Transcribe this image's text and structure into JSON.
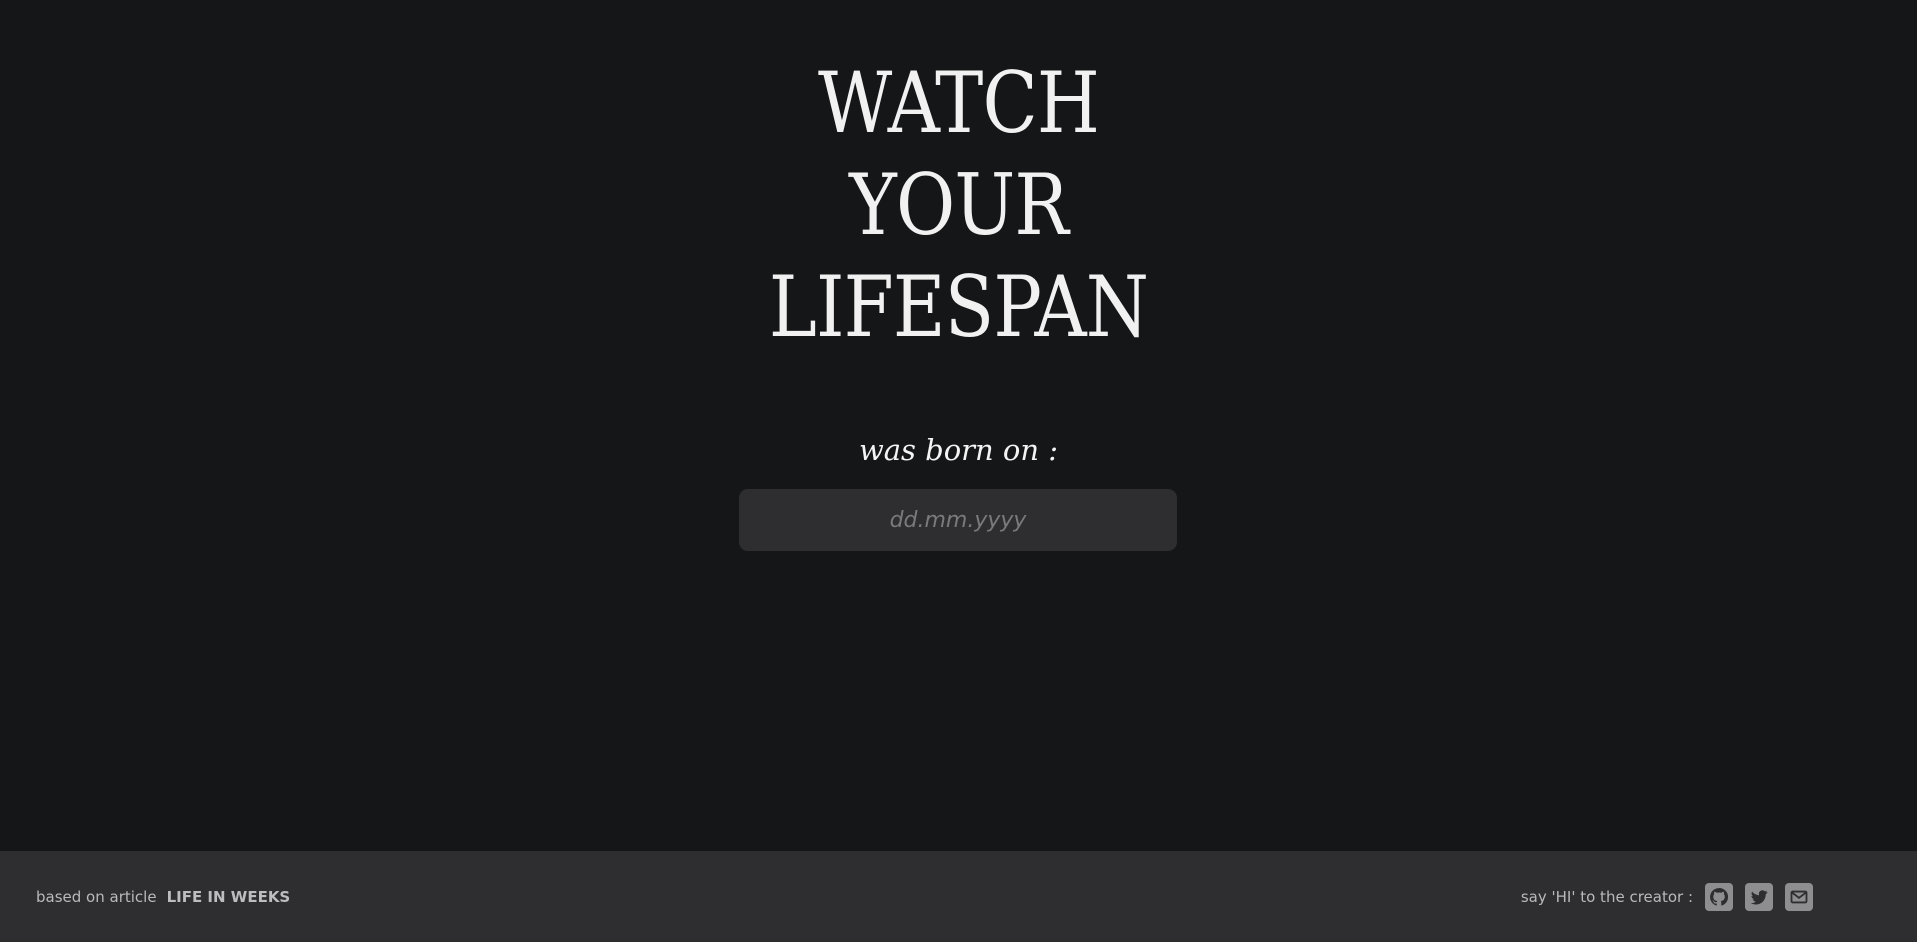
{
  "hero": {
    "title_lines": [
      "WATCH",
      "YOUR",
      "LIFESPAN"
    ],
    "born_label": "was born on :"
  },
  "birth_input": {
    "placeholder": "dd.mm.yyyy",
    "value": ""
  },
  "footer": {
    "based_on_text": "based on article",
    "article_link": "LIFE IN WEEKS",
    "say_hi_text": "say 'HI' to the creator :",
    "socials": [
      {
        "icon": "github-icon"
      },
      {
        "icon": "twitter-icon"
      },
      {
        "icon": "mail-icon"
      }
    ]
  },
  "colors": {
    "background": "#151618",
    "panel": "#2e2e30",
    "title": "#f1f1f1",
    "muted": "#b9b9bb",
    "icon": "#8e8e91"
  }
}
